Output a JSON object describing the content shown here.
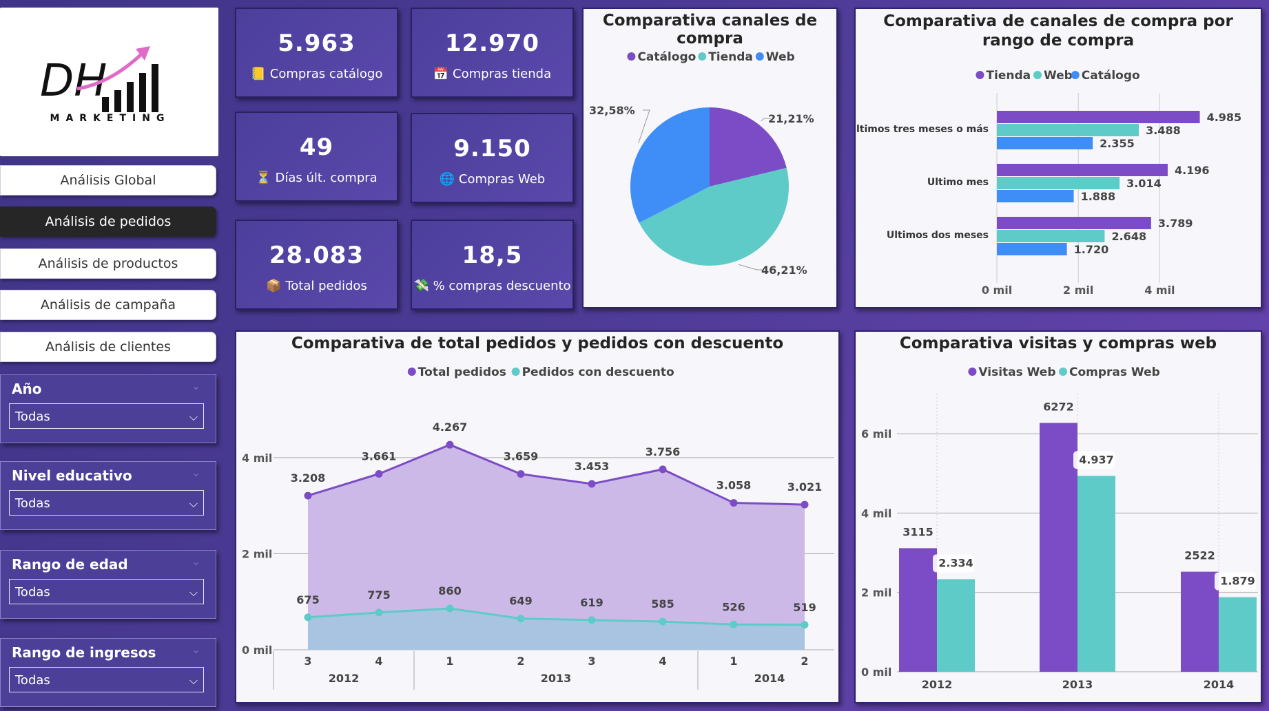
{
  "logo": {
    "letters": "DH",
    "sub": "MARKETING"
  },
  "nav": [
    {
      "label": "Análisis Global",
      "active": false
    },
    {
      "label": "Análisis de pedidos",
      "active": true
    },
    {
      "label": "Análisis de productos",
      "active": false
    },
    {
      "label": "Análisis de campaña",
      "active": false
    },
    {
      "label": "Análisis de clientes",
      "active": false
    }
  ],
  "filters": [
    {
      "title": "Año",
      "value": "Todas"
    },
    {
      "title": "Nivel educativo",
      "value": "Todas"
    },
    {
      "title": "Rango de edad",
      "value": "Todas"
    },
    {
      "title": "Rango de ingresos",
      "value": "Todas"
    }
  ],
  "kpis": [
    {
      "value": "5.963",
      "label": "Compras catálogo",
      "icon": "notepad-icon",
      "glyph": "📒"
    },
    {
      "value": "12.970",
      "label": "Compras tienda",
      "icon": "calendar-icon",
      "glyph": "📅"
    },
    {
      "value": "49",
      "label": "Días últ. compra",
      "icon": "hourglass-icon",
      "glyph": "⏳"
    },
    {
      "value": "9.150",
      "label": "Compras Web",
      "icon": "globe-icon",
      "glyph": "🌐"
    },
    {
      "value": "28.083",
      "label": "Total pedidos",
      "icon": "package-icon",
      "glyph": "📦"
    },
    {
      "value": "18,5",
      "label": "% compras descuento",
      "icon": "money-icon",
      "glyph": "💸"
    }
  ],
  "colors": {
    "purple": "#7b4cc6",
    "teal": "#5ecbc8",
    "blue": "#3f8df7",
    "panel_border": "#2e2370"
  },
  "chart_data": [
    {
      "type": "pie",
      "title": "Comparativa canales de compra",
      "legend": [
        "Catálogo",
        "Tienda",
        "Web"
      ],
      "values": [
        21.21,
        46.21,
        32.58
      ],
      "labels": [
        "21,21%",
        "46,21%",
        "32,58%"
      ],
      "colors": [
        "#7b4cc6",
        "#5ecbc8",
        "#3f8df7"
      ]
    },
    {
      "type": "bar",
      "orientation": "horizontal",
      "title": "Comparativa de canales de compra por rango de compra",
      "categories": [
        "Ultimos tres meses o más",
        "Ultimo mes",
        "Ultimos dos meses"
      ],
      "series": [
        {
          "name": "Tienda",
          "values": [
            4985,
            4196,
            3789
          ],
          "labels": [
            "4.985",
            "4.196",
            "3.789"
          ],
          "color": "#7b4cc6"
        },
        {
          "name": "Web",
          "values": [
            3488,
            3014,
            2648
          ],
          "labels": [
            "3.488",
            "3.014",
            "2.648"
          ],
          "color": "#5ecbc8"
        },
        {
          "name": "Catálogo",
          "values": [
            2355,
            1888,
            1720
          ],
          "labels": [
            "2.355",
            "1.888",
            "1.720"
          ],
          "color": "#3f8df7"
        }
      ],
      "xticks": [
        "0 mil",
        "2 mil",
        "4 mil"
      ],
      "xlim": [
        0,
        5500
      ]
    },
    {
      "type": "area",
      "title": "Comparativa de total pedidos y pedidos con descuento",
      "x_quarters": [
        "3",
        "4",
        "1",
        "2",
        "3",
        "4",
        "1",
        "2"
      ],
      "x_years": [
        "2012",
        "2013",
        "2014"
      ],
      "series": [
        {
          "name": "Total pedidos",
          "values": [
            3208,
            3661,
            4267,
            3659,
            3453,
            3756,
            3058,
            3021
          ],
          "labels": [
            "3.208",
            "3.661",
            "4.267",
            "3.659",
            "3.453",
            "3.756",
            "3.058",
            "3.021"
          ],
          "color": "#7b4cc6"
        },
        {
          "name": "Pedidos con descuento",
          "values": [
            675,
            775,
            860,
            649,
            619,
            585,
            526,
            519
          ],
          "labels": [
            "675",
            "775",
            "860",
            "649",
            "619",
            "585",
            "526",
            "519"
          ],
          "color": "#5ecbc8"
        }
      ],
      "yticks": [
        "0 mil",
        "2 mil",
        "4 mil"
      ],
      "ylim": [
        0,
        4900
      ]
    },
    {
      "type": "bar",
      "title": "Comparativa visitas y compras web",
      "categories": [
        "2012",
        "2013",
        "2014"
      ],
      "series": [
        {
          "name": "Visitas Web",
          "values": [
            3115,
            6272,
            2522
          ],
          "labels": [
            "3115",
            "6272",
            "2522"
          ],
          "color": "#7b4cc6"
        },
        {
          "name": "Compras Web",
          "values": [
            2334,
            4937,
            1879
          ],
          "labels": [
            "2.334",
            "4.937",
            "1.879"
          ],
          "color": "#5ecbc8"
        }
      ],
      "yticks": [
        "0 mil",
        "2 mil",
        "4 mil",
        "6 mil"
      ],
      "ylim": [
        0,
        6800
      ]
    }
  ]
}
